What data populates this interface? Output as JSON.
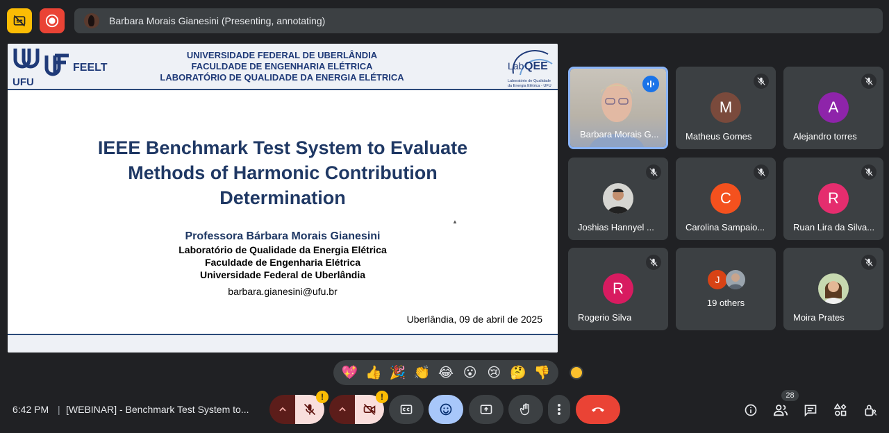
{
  "presenter_bar": {
    "text": "Barbara Morais Gianesini (Presenting, annotating)"
  },
  "slide": {
    "header_left": [
      "UFU",
      "FEELT"
    ],
    "university_lines": [
      "UNIVERSIDADE FEDERAL DE UBERLÂNDIA",
      "FACULDADE DE ENGENHARIA ELÉTRICA",
      "LABORATÓRIO DE QUALIDADE DA ENERGIA ELÉTRICA"
    ],
    "lab_logo": {
      "lab": "Lab",
      "qee": "QEE",
      "caption_1": "Laboratório de Qualidade",
      "caption_2": "da Energia Elétrica - UFU"
    },
    "title_lines": [
      "IEEE Benchmark Test System to Evaluate",
      "Methods of Harmonic Contribution",
      "Determination"
    ],
    "author": "Professora Bárbara Morais Gianesini",
    "affiliations": [
      "Laboratório de Qualidade da Energia Elétrica",
      "Faculdade de Engenharia Elétrica",
      "Universidade Federal de Uberlândia"
    ],
    "email": "barbara.gianesini@ufu.br",
    "date_line": "Uberlândia, 09 de abril de 2025"
  },
  "participants": [
    {
      "name": "Barbara Morais G...",
      "type": "video",
      "speaking": true
    },
    {
      "name": "Matheus Gomes",
      "letter": "M",
      "color": "#7a4a3c",
      "muted": true
    },
    {
      "name": "Alejandro torres",
      "letter": "A",
      "color": "#8e24aa",
      "muted": true
    },
    {
      "name": "Joshias Hannyel ...",
      "type": "photo",
      "muted": true
    },
    {
      "name": "Carolina Sampaio...",
      "letter": "C",
      "color": "#f4511e",
      "muted": true
    },
    {
      "name": "Ruan Lira da Silva...",
      "letter": "R",
      "color": "#e52d6e",
      "muted": true
    },
    {
      "name": "Rogerio Silva",
      "letter": "R",
      "color": "#d81b60",
      "muted": true
    },
    {
      "name": "19 others",
      "type": "others",
      "small_letter": "J"
    },
    {
      "name": "Moira Prates",
      "type": "photo",
      "muted": true
    }
  ],
  "reactions": [
    "💖",
    "👍",
    "🎉",
    "👏",
    "😂",
    "😮",
    "😢",
    "🤔",
    "👎"
  ],
  "bottom_bar": {
    "time": "6:42 PM",
    "separator": "|",
    "meeting_title": "[WEBINAR] - Benchmark Test System to...",
    "participant_count": "28",
    "warning": "!"
  },
  "colors": {
    "accent": "#8ab4f8",
    "end_call": "#ea4335",
    "warning": "#fbbc04",
    "slide_title": "#1f3864"
  }
}
